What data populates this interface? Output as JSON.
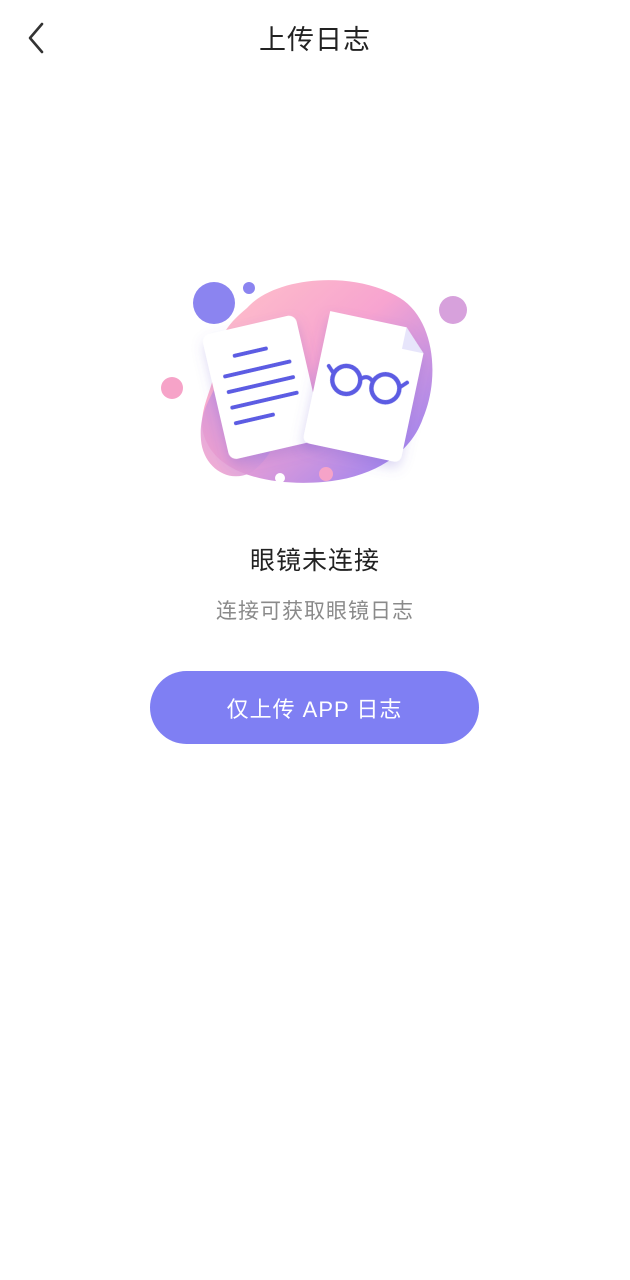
{
  "header": {
    "title": "上传日志",
    "back_icon": "chevron-left-icon"
  },
  "illustration": {
    "icon": "document-glasses-illustration",
    "colors": {
      "accent": "#7f7ff3",
      "pink": "#f6a3c8",
      "blob_start": "#ffb3c9",
      "blob_end": "#8e7cf4",
      "line": "#5a5ae0"
    }
  },
  "status": {
    "title": "眼镜未连接",
    "subtitle": "连接可获取眼镜日志"
  },
  "actions": {
    "upload_app_log_label": "仅上传 APP 日志"
  },
  "colors": {
    "button": "#7f7ff3",
    "text_primary": "#222222",
    "text_secondary": "#8a8a8a"
  }
}
